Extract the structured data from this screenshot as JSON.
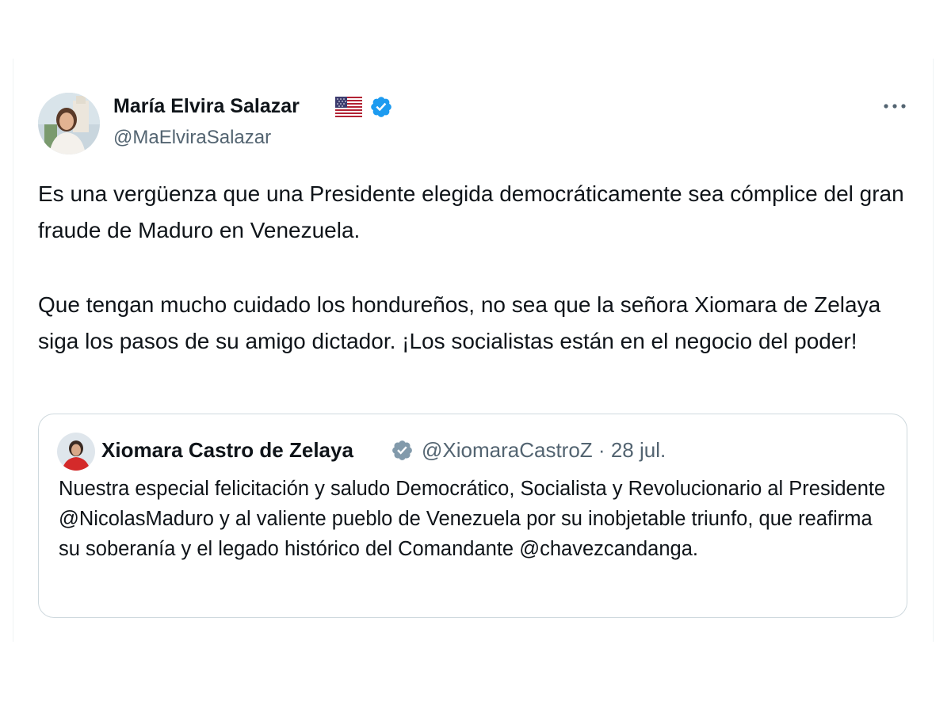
{
  "tweet": {
    "author": {
      "name": "María Elvira Salazar",
      "handle": "@MaElviraSalazar",
      "flag_icon": "us-flag-icon",
      "verified_icon": "verified-badge-icon",
      "verified_color": "#1d9bf0"
    },
    "more_icon": "more-options-icon",
    "paragraphs": [
      "Es una vergüenza que una Presidente elegida democráticamente sea cómplice del gran fraude de Maduro en Venezuela.",
      "Que tengan mucho cuidado los hondureños, no sea que la señora Xiomara de Zelaya siga los pasos de su amigo dictador. ¡Los socialistas están en el negocio del poder!"
    ],
    "quoted": {
      "name": "Xiomara Castro de Zelaya",
      "handle": "@XiomaraCastroZ",
      "separator": "·",
      "date": "28 jul.",
      "verified_icon": "government-verified-badge-icon",
      "verified_color": "#829aab",
      "text": "Nuestra especial felicitación y saludo Democrático, Socialista y Revolucionario al  Presidente @NicolasMaduro y al valiente pueblo de Venezuela por su inobjetable triunfo, que reafirma su soberanía y el legado histórico del Comandante @chavezcandanga."
    }
  },
  "colors": {
    "text_primary": "#0f1419",
    "text_secondary": "#536471",
    "border": "#cfd9de",
    "accent": "#1d9bf0"
  }
}
